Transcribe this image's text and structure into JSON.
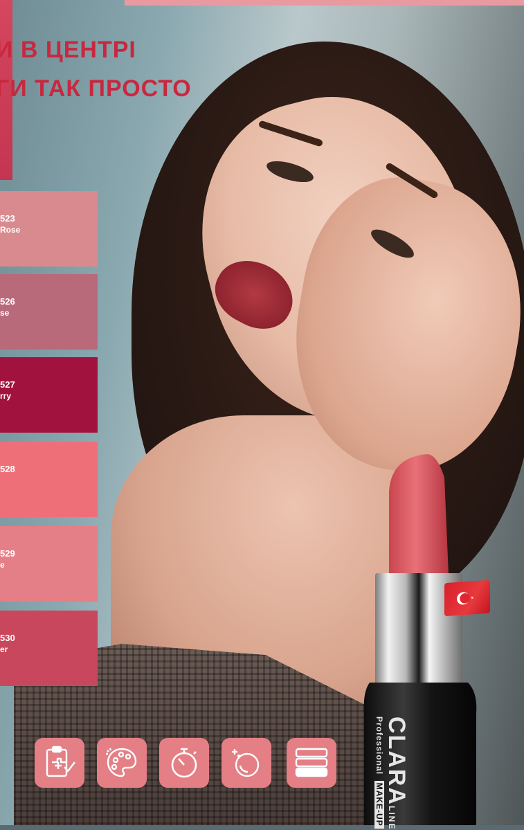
{
  "headline": {
    "line1": "И В ЦЕНТРІ",
    "line2": "ГИ ТАК ПРОСТО"
  },
  "swatches": [
    {
      "code": "523",
      "name": "Rose",
      "color": "#d98a8e"
    },
    {
      "code": "526",
      "name": "se",
      "color": "#b96a7a"
    },
    {
      "code": "527",
      "name": "rry",
      "color": "#a1133e"
    },
    {
      "code": "528",
      "name": "",
      "color": "#ef6f79"
    },
    {
      "code": "529",
      "name": "e",
      "color": "#e47f88"
    },
    {
      "code": "530",
      "name": "er",
      "color": "#c9475c"
    }
  ],
  "icons": [
    {
      "name": "clipboard-check-icon"
    },
    {
      "name": "palette-icon"
    },
    {
      "name": "stopwatch-icon"
    },
    {
      "name": "sparkle-drop-icon"
    },
    {
      "name": "layers-icon"
    }
  ],
  "product": {
    "brand": "CLARA",
    "brand_suffix": "LINE",
    "tagline_1": "Professional",
    "tagline_2": "MAKE-UP",
    "bullet_color": "#d85a62",
    "flag": "turkey-flag"
  },
  "colors": {
    "headline": "#c8283f",
    "icon_tile": "#e47f85"
  }
}
